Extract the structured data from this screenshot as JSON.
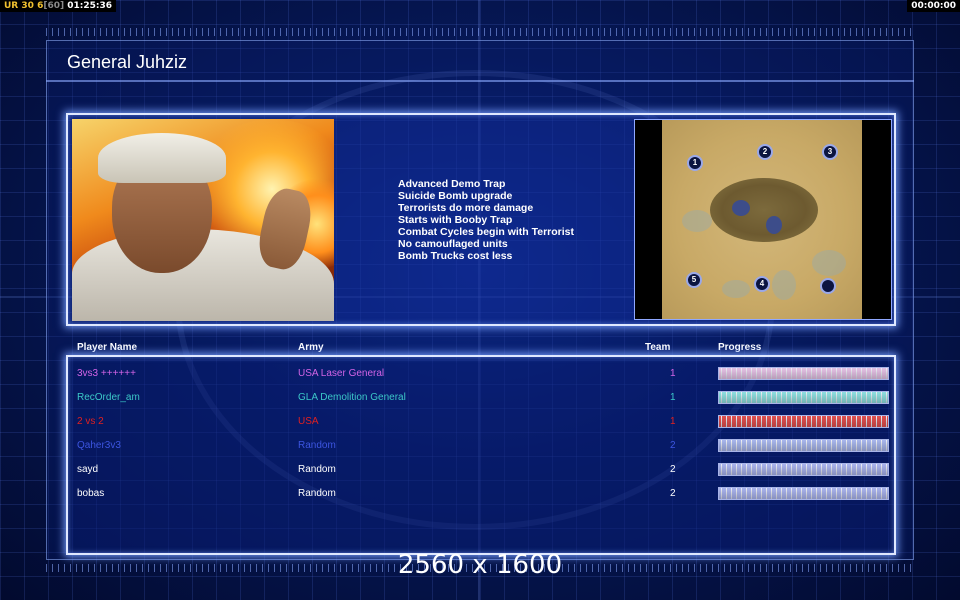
{
  "hud": {
    "tag": "UR",
    "fps": "30",
    "fps_value": "6",
    "fps_limit": "[60]",
    "clock": "01:25:36",
    "timer": "00:00:00"
  },
  "general_title": "General Juhziz",
  "upgrades": [
    "Advanced Demo Trap",
    "Suicide Bomb upgrade",
    "Terrorists do more damage",
    "Starts with Booby Trap",
    "Combat Cycles begin with Terrorist",
    "No camouflaged units",
    "Bomb Trucks cost less"
  ],
  "map": {
    "start_positions": [
      "1",
      "2",
      "3",
      "4",
      "5",
      ""
    ]
  },
  "table": {
    "headers": {
      "name": "Player Name",
      "army": "Army",
      "team": "Team",
      "progress": "Progress"
    },
    "players": [
      {
        "name": "3vs3 ++++++",
        "army": "USA Laser General",
        "team": "1",
        "color": "#d264e6",
        "bar": "#e6c2e6",
        "progress": 1.0
      },
      {
        "name": "RecOrder_am",
        "army": "GLA Demolition General",
        "team": "1",
        "color": "#3cc8c8",
        "bar": "#8fe0e0",
        "progress": 1.0
      },
      {
        "name": "2 vs 2",
        "army": "USA",
        "team": "1",
        "color": "#e02020",
        "bar": "#e05050",
        "progress": 1.0
      },
      {
        "name": "Qaher3v3",
        "army": "Random",
        "team": "2",
        "color": "#3c55e0",
        "bar": "#a8b6ec",
        "progress": 1.0
      },
      {
        "name": "sayd",
        "army": "Random",
        "team": "2",
        "color": "#ffffff",
        "bar": "#aab4ee",
        "progress": 1.0
      },
      {
        "name": "bobas",
        "army": "Random",
        "team": "2",
        "color": "#ffffff",
        "bar": "#aab4ee",
        "progress": 1.0
      }
    ]
  },
  "watermark": "2560 x 1600"
}
